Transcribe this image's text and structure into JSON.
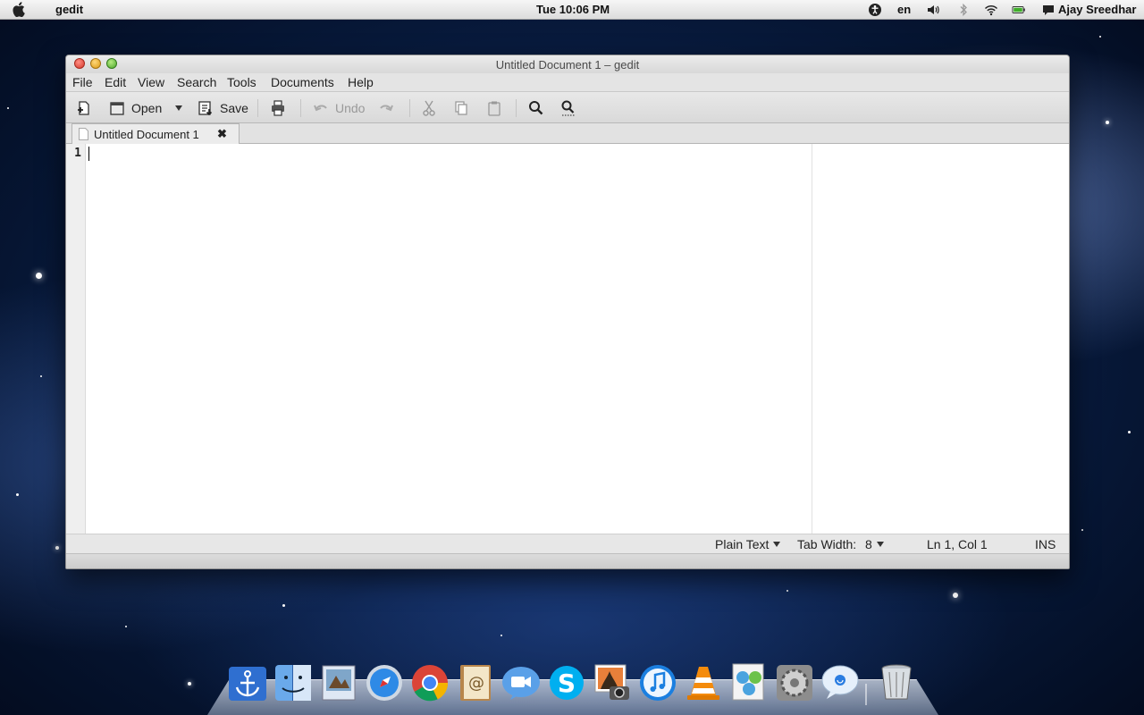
{
  "menubar": {
    "app_name": "gedit",
    "clock": "Tue 10:06 PM",
    "language": "en",
    "user": "Ajay Sreedhar",
    "status_icons": [
      "accessibility-icon",
      "volume-icon",
      "bluetooth-icon",
      "wifi-icon",
      "battery-icon",
      "chat-bubble-icon"
    ]
  },
  "window": {
    "title": "Untitled Document 1 – gedit",
    "menus": [
      "File",
      "Edit",
      "View",
      "Search",
      "Tools",
      "Documents",
      "Help"
    ],
    "toolbar": {
      "open_label": "Open",
      "save_label": "Save",
      "undo_label": "Undo"
    },
    "tab": {
      "label": "Untitled Document 1",
      "close_glyph": "✖"
    },
    "editor": {
      "line_numbers": [
        "1"
      ],
      "content": ""
    },
    "statusbar": {
      "language": "Plain Text",
      "tab_width_label": "Tab Width:",
      "tab_width_value": "8",
      "cursor_position": "Ln 1, Col 1",
      "insert_mode": "INS"
    }
  },
  "dock": {
    "apps": [
      "anchor-icon",
      "finder-icon",
      "preview-icon",
      "safari-icon",
      "chrome-icon",
      "contacts-icon",
      "facetime-icon",
      "skype-icon",
      "iphoto-icon",
      "itunes-icon",
      "vlc-icon",
      "network-icon",
      "system-preferences-icon",
      "messages-icon",
      "trash-icon"
    ]
  },
  "colors": {
    "menubar_bg": "#e6e6e6",
    "window_bg": "#e9e9e9",
    "editor_bg": "#ffffff",
    "close_red": "#e0443a",
    "minimize_yellow": "#e5a421",
    "zoom_green": "#58b033"
  }
}
